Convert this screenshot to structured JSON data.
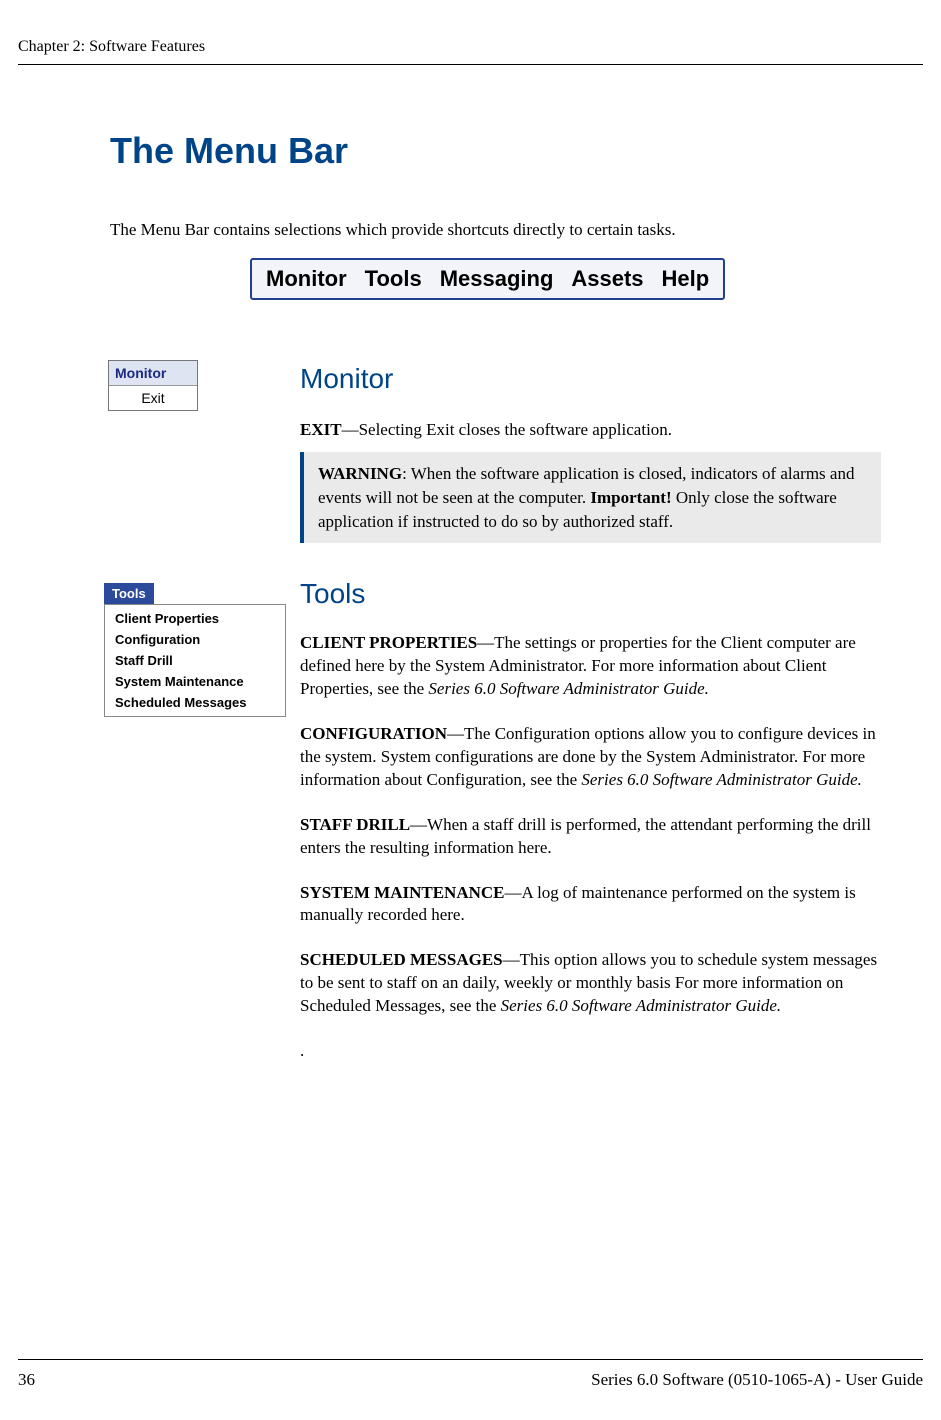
{
  "header": {
    "chapter_title": "Chapter 2: Software Features"
  },
  "main": {
    "heading": "The Menu Bar",
    "intro": "The Menu Bar contains selections which provide shortcuts directly to certain tasks."
  },
  "menubar_graphic": {
    "items": [
      "Monitor",
      "Tools",
      "Messaging",
      "Assets",
      "Help"
    ]
  },
  "monitor": {
    "sidebar_header": "Monitor",
    "sidebar_item": "Exit",
    "heading": "Monitor",
    "exit_label": "EXIT",
    "exit_text": "—Selecting Exit closes the software application.",
    "warning_label": "WARNING",
    "warning_text_1": ": When the software application is closed, indicators of alarms and events will not be seen at the computer. ",
    "warning_bold": "Important!",
    "warning_text_2": " Only close the software application if instructed to do so by authorized staff."
  },
  "tools": {
    "sidebar_header": "Tools",
    "sidebar_items": [
      "Client Properties",
      "Configuration",
      "Staff Drill",
      "System Maintenance",
      "Scheduled Messages"
    ],
    "heading": "Tools",
    "client_props_label": "CLIENT PROPERTIES",
    "client_props_text": "—The settings or properties for the Client computer are defined here by the System Administrator. For more information about Client Properties, see the ",
    "guide_ref": "Series 6.0 Software Administrator Guide.",
    "config_label": "CONFIGURATION",
    "config_text": "—The Configuration options allow you to configure devices in the system. System configurations are done by the System Administrator. For more information about Configuration, see the ",
    "staff_drill_label": "STAFF DRILL",
    "staff_drill_text": "—When a staff drill is performed, the attendant performing the drill enters the resulting information here.",
    "sys_maint_label": "SYSTEM MAINTENANCE",
    "sys_maint_text": "—A log of maintenance performed on the system is manually recorded here.",
    "sched_msg_label": "SCHEDULED MESSAGES",
    "sched_msg_text": "—This option allows you to schedule system messages to be sent to staff on an daily, weekly or monthly basis For more information on Scheduled Messages, see the ",
    "dot": "."
  },
  "footer": {
    "page_number": "36",
    "doc_ref": "Series 6.0 Software (0510-1065-A) - User Guide"
  }
}
